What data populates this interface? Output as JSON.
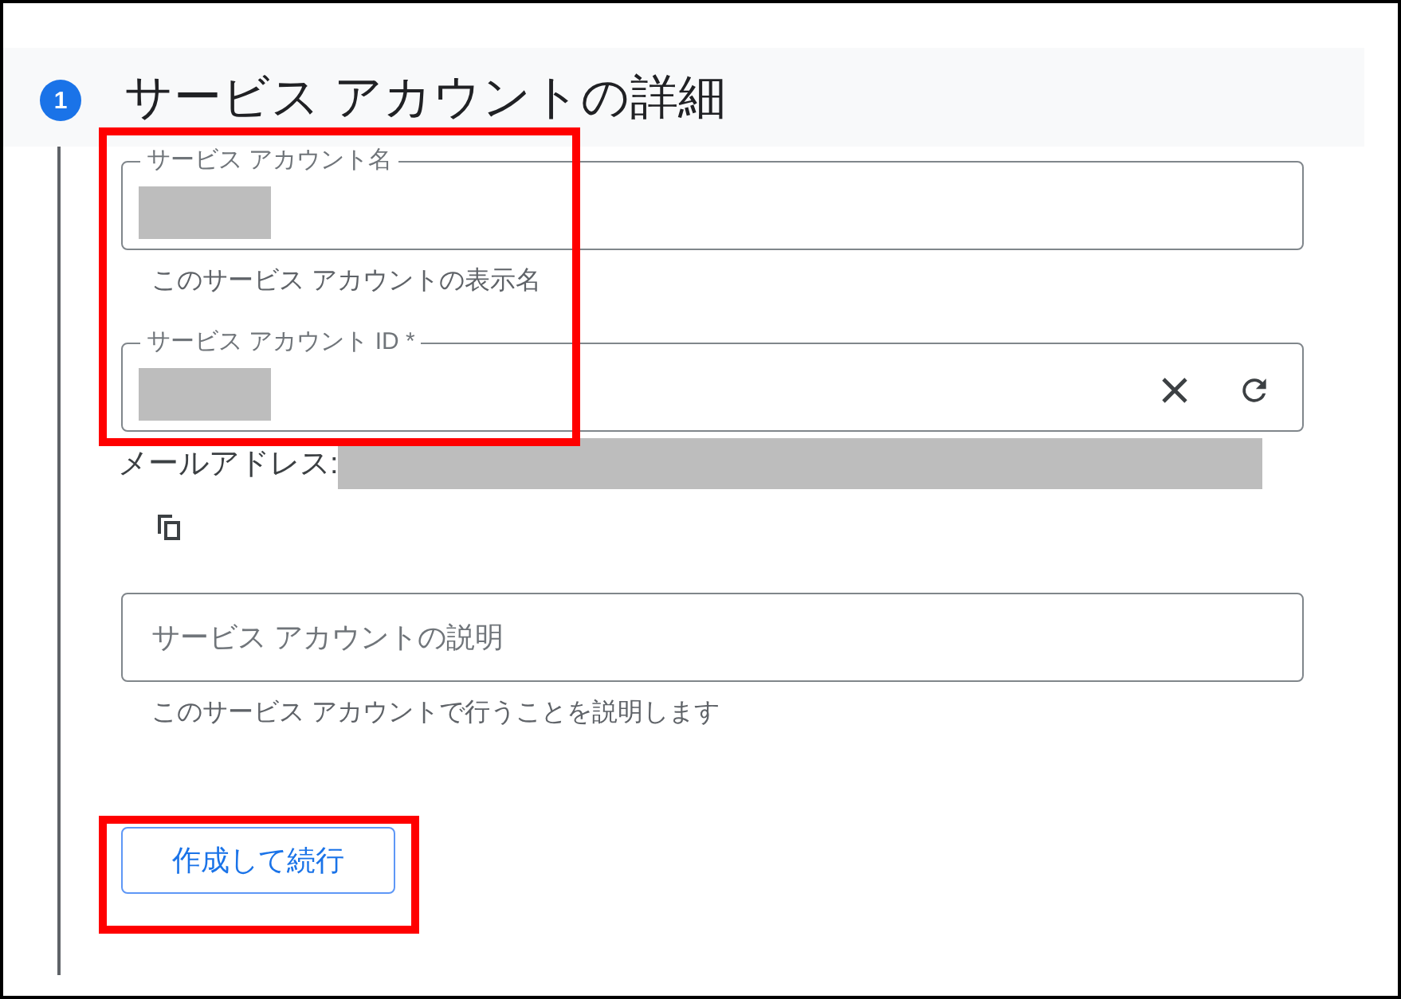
{
  "step": {
    "number": "1",
    "title": "サービス アカウントの詳細"
  },
  "fields": [
    {
      "kind": "labeled",
      "label": "サービス アカウント名",
      "value_redacted": true,
      "helper": "このサービス アカウントの表示名"
    },
    {
      "kind": "labeled-actions",
      "label": "サービス アカウント ID *",
      "value_redacted": true,
      "actions": [
        {
          "kind": "clear"
        },
        {
          "kind": "refresh"
        }
      ]
    },
    {
      "kind": "email",
      "label": "メールアドレス:",
      "value_redacted": true
    },
    {
      "kind": "copy"
    },
    {
      "kind": "placeholder",
      "placeholder": "サービス アカウントの説明",
      "helper": "このサービス アカウントで行うことを説明します"
    }
  ],
  "button": {
    "label": "作成して続行"
  },
  "annotations": [
    {
      "kind": "highlight"
    },
    {
      "kind": "highlight"
    }
  ]
}
